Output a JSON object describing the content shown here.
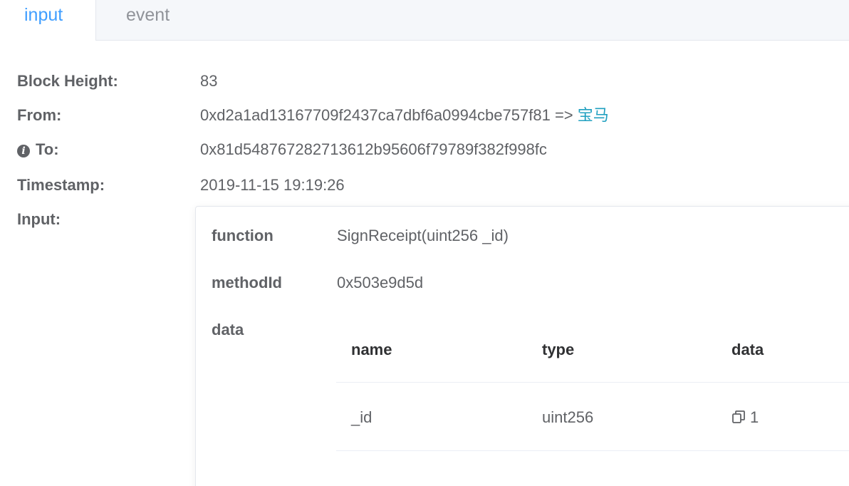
{
  "tabs": [
    {
      "label": "input",
      "active": true
    },
    {
      "label": "event",
      "active": false
    }
  ],
  "details": {
    "block_height_label": "Block Height:",
    "block_height_value": "83",
    "from_label": "From:",
    "from_address": "0xd2a1ad13167709f2437ca7dbf6a0994cbe757f81",
    "from_arrow": "=>",
    "from_name": "宝马",
    "to_label": "To:",
    "to_address": "0x81d548767282713612b95606f79789f382f998fc",
    "timestamp_label": "Timestamp:",
    "timestamp_value": "2019-11-15 19:19:26",
    "input_label": "Input:"
  },
  "input_card": {
    "function_label": "function",
    "function_value": "SignReceipt(uint256 _id)",
    "method_label": "methodId",
    "method_value": "0x503e9d5d",
    "data_label": "data",
    "table": {
      "headers": [
        "name",
        "type",
        "data"
      ],
      "rows": [
        {
          "name": "_id",
          "type": "uint256",
          "data": "1"
        }
      ]
    }
  },
  "icons": {
    "info": "info-circle-icon",
    "copy": "copy-icon"
  },
  "colors": {
    "active_tab": "#409eff",
    "link": "#20a0c0",
    "text": "#606266"
  }
}
